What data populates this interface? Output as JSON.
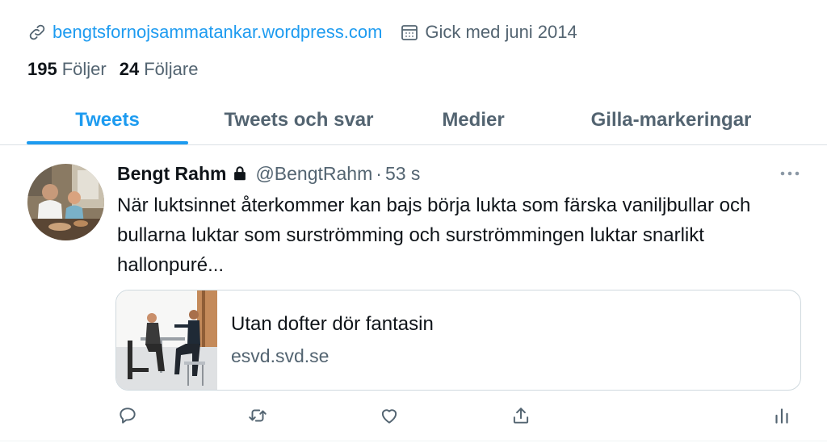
{
  "profile": {
    "website": "bengtsfornojsammatankar.wordpress.com",
    "joined": "Gick med juni 2014",
    "following_count": "195",
    "following_label": "Följer",
    "followers_count": "24",
    "followers_label": "Följare",
    "link_icon": "link-icon",
    "calendar_icon": "calendar-icon"
  },
  "tabs": [
    {
      "label": "Tweets",
      "active": true
    },
    {
      "label": "Tweets och svar",
      "active": false
    },
    {
      "label": "Medier",
      "active": false
    },
    {
      "label": "Gilla-markeringar",
      "active": false
    }
  ],
  "tweet": {
    "author_name": "Bengt Rahm",
    "handle": "@BengtRahm",
    "separator": "·",
    "time": "53 s",
    "text": "När luktsinnet återkommer kan bajs börja lukta som färska vaniljbullar och bullarna luktar som surströmming och surströmmingen luktar snarlikt hallonpuré...",
    "card": {
      "title": "Utan dofter dör fantasin",
      "domain": "esvd.svd.se"
    },
    "actions": [
      "reply-icon",
      "retweet-icon",
      "like-icon",
      "share-icon",
      "analytics-icon"
    ]
  },
  "colors": {
    "accent": "#1d9bf0",
    "text_primary": "#0f1419",
    "text_secondary": "#536471",
    "border": "#cfd9de"
  }
}
